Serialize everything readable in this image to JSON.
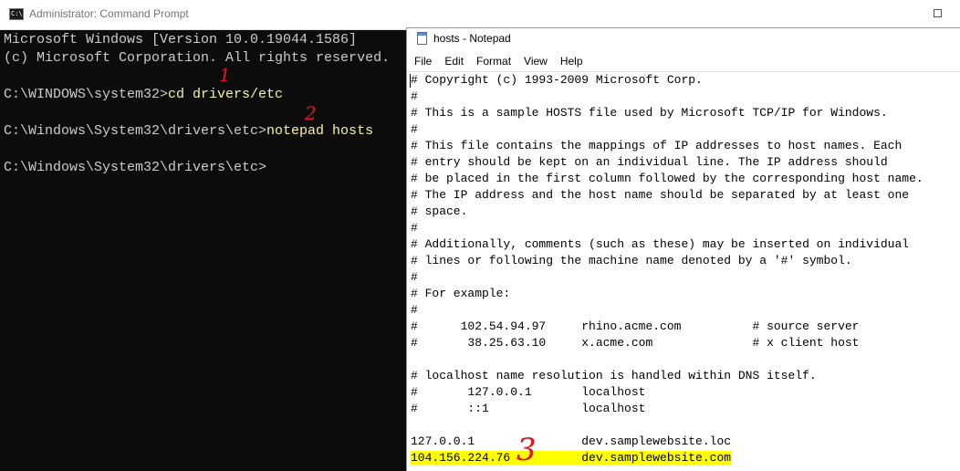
{
  "cmd": {
    "icon_text": "C:\\",
    "title": "Administrator: Command Prompt",
    "lines": [
      {
        "text": "Microsoft Windows [Version 10.0.19044.1586]",
        "prompt": "",
        "command": ""
      },
      {
        "text": "(c) Microsoft Corporation. All rights reserved.",
        "prompt": "",
        "command": ""
      },
      {
        "text": "",
        "prompt": "",
        "command": ""
      },
      {
        "text": "",
        "prompt": "C:\\WINDOWS\\system32>",
        "command": "cd drivers/etc"
      },
      {
        "text": "",
        "prompt": "",
        "command": ""
      },
      {
        "text": "",
        "prompt": "C:\\Windows\\System32\\drivers\\etc>",
        "command": "notepad hosts"
      },
      {
        "text": "",
        "prompt": "",
        "command": ""
      },
      {
        "text": "",
        "prompt": "C:\\Windows\\System32\\drivers\\etc>",
        "command": ""
      }
    ]
  },
  "annotations": {
    "step1": "1",
    "step2": "2",
    "step3": "3"
  },
  "notepad": {
    "title": "hosts - Notepad",
    "menu": [
      "File",
      "Edit",
      "Format",
      "View",
      "Help"
    ],
    "lines": [
      "# Copyright (c) 1993-2009 Microsoft Corp.",
      "#",
      "# This is a sample HOSTS file used by Microsoft TCP/IP for Windows.",
      "#",
      "# This file contains the mappings of IP addresses to host names. Each",
      "# entry should be kept on an individual line. The IP address should",
      "# be placed in the first column followed by the corresponding host name.",
      "# The IP address and the host name should be separated by at least one",
      "# space.",
      "#",
      "# Additionally, comments (such as these) may be inserted on individual",
      "# lines or following the machine name denoted by a '#' symbol.",
      "#",
      "# For example:",
      "#",
      "#      102.54.94.97     rhino.acme.com          # source server",
      "#       38.25.63.10     x.acme.com              # x client host",
      "",
      "# localhost name resolution is handled within DNS itself.",
      "#       127.0.0.1       localhost",
      "#       ::1             localhost",
      "",
      "127.0.0.1               dev.samplewebsite.loc",
      "104.156.224.76          dev.samplewebsite.com"
    ],
    "highlighted_line_index": 23
  },
  "colors": {
    "cmd_background": "#0c0c0c",
    "cmd_text": "#cccccc",
    "cmd_command": "#f9f1a5",
    "annotation": "#e81123",
    "highlight": "#ffff00"
  }
}
